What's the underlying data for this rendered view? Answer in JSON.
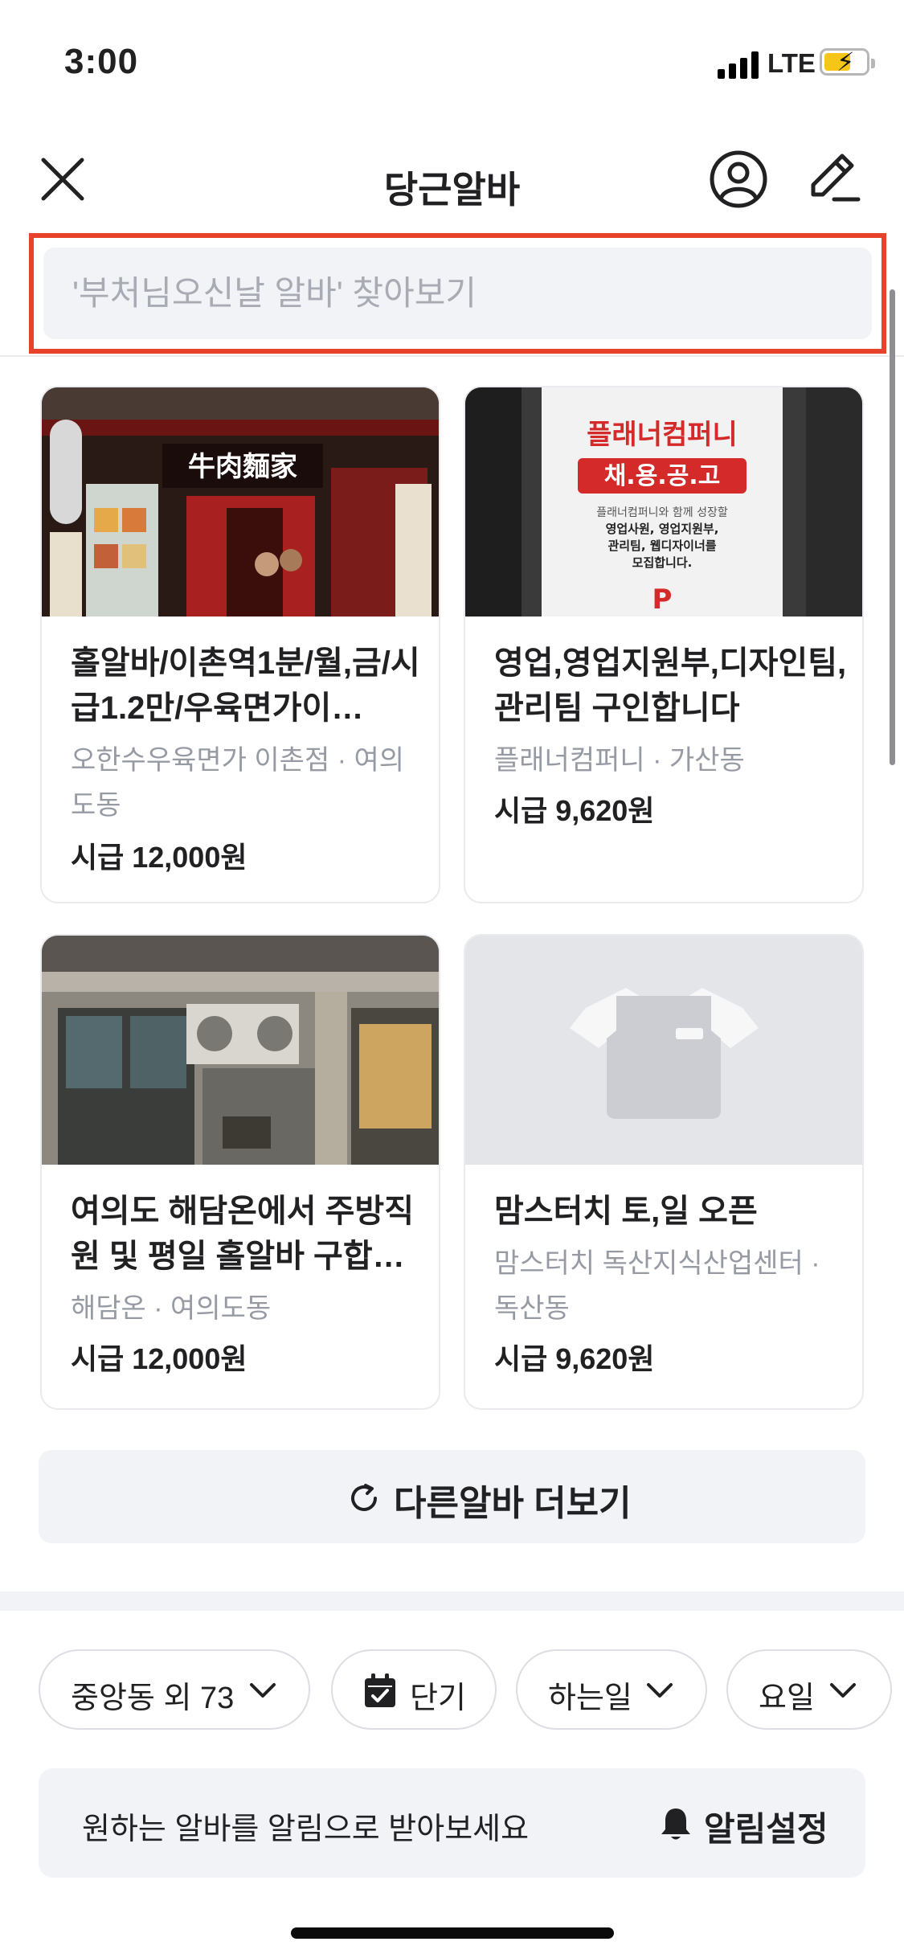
{
  "status_bar": {
    "time": "3:00",
    "network": "LTE"
  },
  "header": {
    "title": "당근알바"
  },
  "search": {
    "placeholder": "'부처님오신날 알바' 찾아보기"
  },
  "jobs": [
    {
      "title": "홀알바/이촌역1분/월,금/시급1.2만/우육면가이…",
      "meta": "오한수우육면가 이촌점 · 여의도동",
      "wage": "시급 12,000원",
      "image": "restaurant-storefront-photo",
      "image_text": "牛肉麵家"
    },
    {
      "title": "영업,영업지원부,디자인팀,관리팀 구인합니다",
      "meta": "플래너컴퍼니 · 가산동",
      "wage": "시급 9,620원",
      "image": "recruitment-poster",
      "poster": {
        "company": "플래너컴퍼니",
        "banner": "채.용.공.고",
        "lines": [
          "플래너컴퍼니와 함께 성장할",
          "영업사원, 영업지원부,",
          "관리팀, 웹디자이너를",
          "모집합니다."
        ],
        "logo": "P"
      }
    },
    {
      "title": "여의도 해담온에서 주방직원 및 평일 홀알바 구합…",
      "meta": "해담온 · 여의도동",
      "wage": "시급 12,000원",
      "image": "building-exterior-photo"
    },
    {
      "title": "맘스터치 토,일 오픈",
      "meta": "맘스터치 독산지식산업센터 · 독산동",
      "wage": "시급 9,620원",
      "image": "apron-placeholder-icon"
    }
  ],
  "more_button": {
    "label": "다른알바 더보기"
  },
  "filters": [
    {
      "label": "중앙동 외 73",
      "icon": "chevron-down-icon"
    },
    {
      "label": "단기",
      "icon": "calendar-check-icon"
    },
    {
      "label": "하는일",
      "icon": "chevron-down-icon"
    },
    {
      "label": "요일",
      "icon": "chevron-down-icon"
    }
  ],
  "alert": {
    "text": "원하는 알바를 알림으로 받아보세요",
    "button_label": "알림설정"
  },
  "colors": {
    "highlight": "#e8412c",
    "text": "#212124",
    "muted": "#969aa3",
    "surface": "#f2f3f6",
    "border": "#eaebee"
  }
}
